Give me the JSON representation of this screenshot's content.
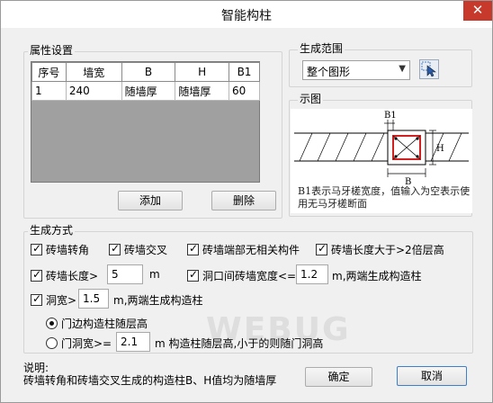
{
  "window": {
    "title": "智能构柱",
    "close_glyph": "✕"
  },
  "attributes": {
    "legend": "属性设置",
    "columns": [
      "序号",
      "墙宽",
      "B",
      "H",
      "B1"
    ],
    "rows": [
      [
        "1",
        "240",
        "随墙厚",
        "随墙厚",
        "60"
      ]
    ],
    "add_label": "添加",
    "delete_label": "删除"
  },
  "range": {
    "legend": "生成范围",
    "selected": "整个图形"
  },
  "preview": {
    "legend": "示图",
    "label_b1": "B1",
    "label_b": "B",
    "label_h": "H",
    "note": "B1表示马牙槎宽度，值输入为空表示使用无马牙槎断面"
  },
  "mode": {
    "legend": "生成方式",
    "options": {
      "corner": {
        "label": "砖墙转角",
        "checked": true
      },
      "cross": {
        "label": "砖墙交叉",
        "checked": true
      },
      "end_no_member": {
        "label": "砖墙端部无相关构件",
        "checked": true
      },
      "length_over": {
        "label": "砖墙长度大于>2倍层高",
        "checked": true
      },
      "length_gt": {
        "label": "砖墙长度>",
        "value": "5",
        "unit": "m",
        "checked": true
      },
      "gap_width": {
        "label": "洞口间砖墙宽度<=",
        "value": "1.2",
        "suffix": "m,两端生成构造柱",
        "checked": true
      },
      "hole_width": {
        "label": "洞宽>",
        "value": "1.5",
        "suffix": "m,两端生成构造柱",
        "checked": true
      }
    },
    "radios": {
      "follow_floor": {
        "label": "门边构造柱随层高",
        "checked": true
      },
      "door_width": {
        "label": "门洞宽>=",
        "value": "2.1",
        "suffix": "m 构造柱随层高,小于的则随门洞高",
        "checked": false
      }
    }
  },
  "footer": {
    "note_title": "说明:",
    "note_text": "砖墙转角和砖墙交叉生成的构造柱B、H值均为随墙厚",
    "ok_label": "确定",
    "cancel_label": "取消"
  },
  "watermark": "WEBUG"
}
